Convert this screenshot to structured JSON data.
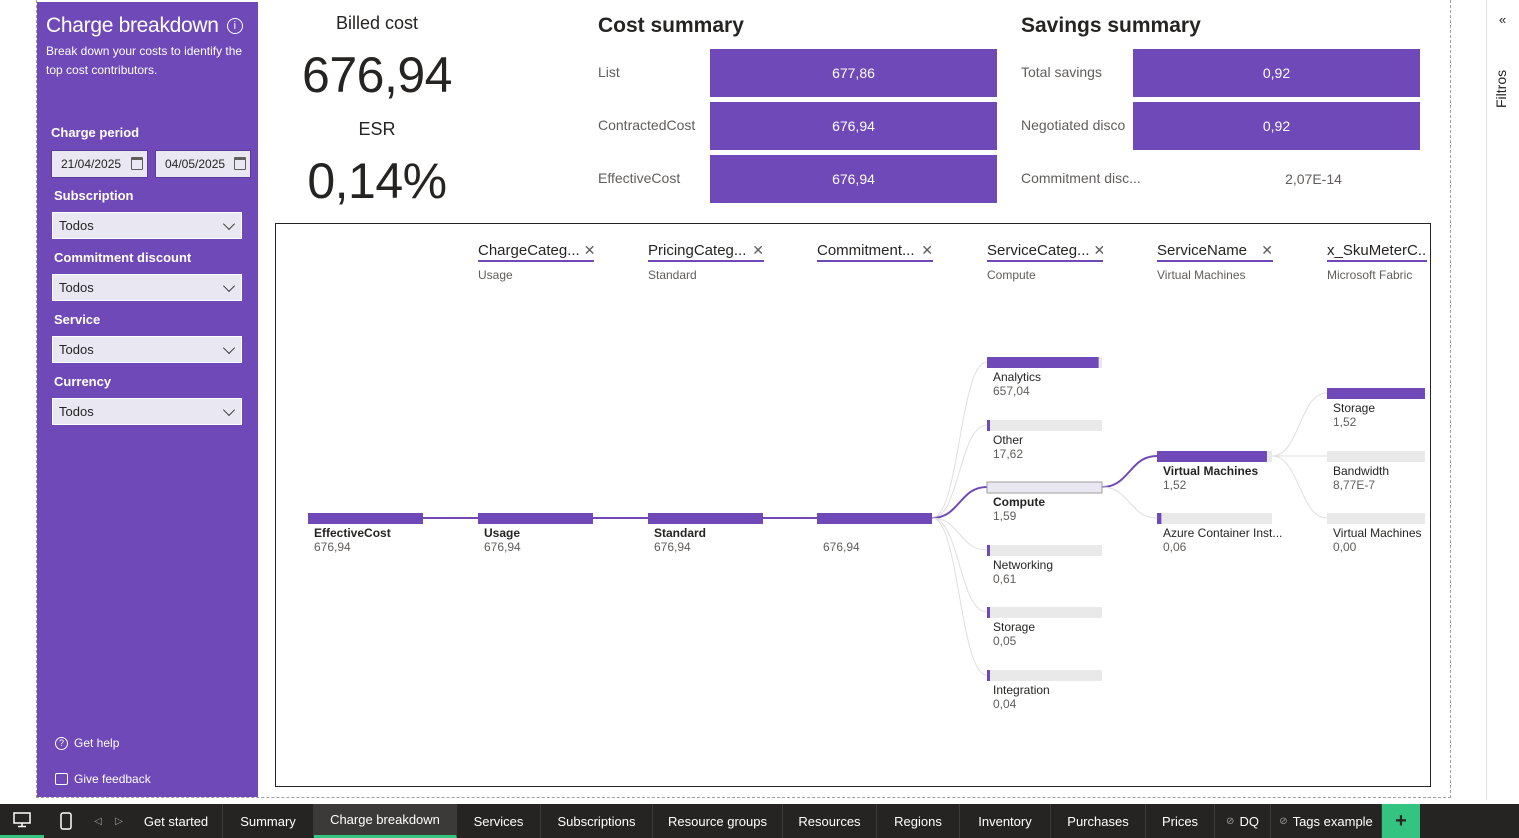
{
  "sidebar": {
    "title": "Charge breakdown",
    "description": "Break down your costs to identify the top cost contributors.",
    "charge_period_label": "Charge period",
    "date_start": "21/04/2025",
    "date_end": "04/05/2025",
    "filters": [
      {
        "label": "Subscription",
        "value": "Todos"
      },
      {
        "label": "Commitment discount",
        "value": "Todos"
      },
      {
        "label": "Service",
        "value": "Todos"
      },
      {
        "label": "Currency",
        "value": "Todos"
      }
    ],
    "help_label": "Get help",
    "feedback_label": "Give feedback",
    "accent_color": "#7049b8"
  },
  "kpis": {
    "billed_label": "Billed cost",
    "billed_value": "676,94",
    "esr_label": "ESR",
    "esr_value": "0,14%"
  },
  "cost_summary": {
    "title": "Cost summary",
    "rows": [
      {
        "label": "List",
        "value": "677,86"
      },
      {
        "label": "ContractedCost",
        "value": "676,94"
      },
      {
        "label": "EffectiveCost",
        "value": "676,94"
      }
    ]
  },
  "savings_summary": {
    "title": "Savings summary",
    "rows": [
      {
        "label": "Total savings",
        "value": "0,92"
      },
      {
        "label": "Negotiated disco",
        "value": "0,92"
      },
      {
        "label": "Commitment disc...",
        "value": "2,07E-14"
      }
    ]
  },
  "tree": {
    "levels": [
      {
        "name": "ChargeCateg...",
        "selected": "Usage"
      },
      {
        "name": "PricingCateg...",
        "selected": "Standard"
      },
      {
        "name": "Commitment...",
        "selected": ""
      },
      {
        "name": "ServiceCateg...",
        "selected": "Compute"
      },
      {
        "name": "ServiceName",
        "selected": "Virtual Machines"
      },
      {
        "name": "x_SkuMeterC...",
        "selected": "Microsoft Fabric"
      }
    ],
    "root": {
      "label": "EffectiveCost",
      "value": "676,94"
    },
    "chain": [
      {
        "label": "Usage",
        "value": "676,94"
      },
      {
        "label": "Standard",
        "value": "676,94"
      },
      {
        "label": "",
        "value": "676,94"
      }
    ],
    "service_categories": [
      {
        "label": "Analytics",
        "value": "657,04",
        "fraction": 0.9706
      },
      {
        "label": "Other",
        "value": "17,62",
        "fraction": 0.026
      },
      {
        "label": "Compute",
        "value": "1,59",
        "fraction": 0.0023
      },
      {
        "label": "Networking",
        "value": "0,61",
        "fraction": 0.0009
      },
      {
        "label": "Storage",
        "value": "0,05",
        "fraction": 0.0001
      },
      {
        "label": "Integration",
        "value": "0,04",
        "fraction": 0.0001
      }
    ],
    "service_names": [
      {
        "label": "Virtual Machines",
        "value": "1,52",
        "fraction": 0.956
      },
      {
        "label": "Azure Container Inst...",
        "value": "0,06",
        "fraction": 0.038
      }
    ],
    "sku_meters": [
      {
        "label": "Storage",
        "value": "1,52",
        "fraction": 1.0
      },
      {
        "label": "Bandwidth",
        "value": "8,77E-7",
        "fraction": 0.0
      },
      {
        "label": "Virtual Machines",
        "value": "0,00",
        "fraction": 0.0
      }
    ]
  },
  "filters_pane": {
    "label": "Filtros"
  },
  "tabs": [
    "Get started",
    "Summary",
    "Charge breakdown",
    "Services",
    "Subscriptions",
    "Resource groups",
    "Resources",
    "Regions",
    "Inventory",
    "Purchases",
    "Prices",
    "DQ",
    "Tags example"
  ],
  "active_tab": "Charge breakdown"
}
